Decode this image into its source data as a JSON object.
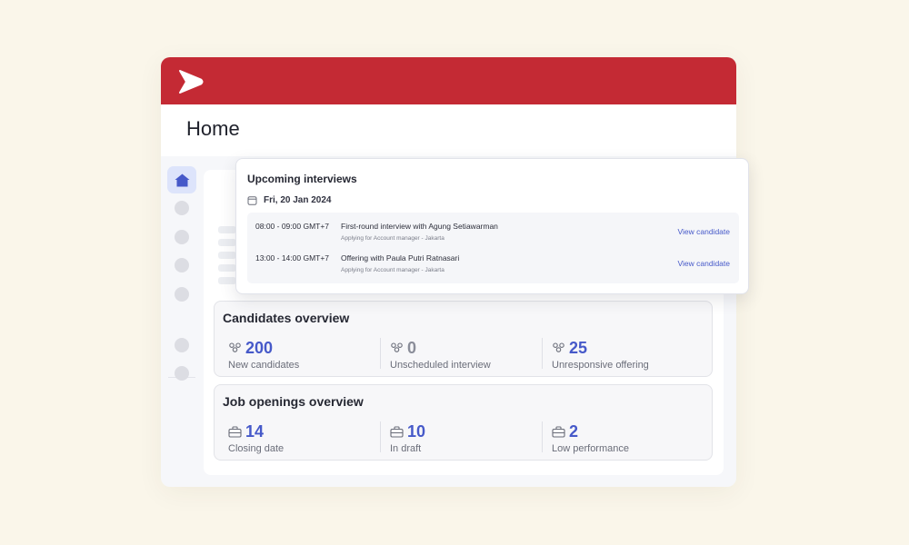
{
  "colors": {
    "brand": "#c42a34",
    "accent": "#4659c9",
    "background": "#faf6ea"
  },
  "header": {
    "title": "Home"
  },
  "sidebar": {
    "items": [
      {
        "icon": "home-icon",
        "active": true
      },
      {
        "icon": "nav-dot"
      },
      {
        "icon": "nav-dot"
      },
      {
        "icon": "nav-dot"
      },
      {
        "icon": "nav-dot"
      },
      {
        "icon": "nav-dot"
      },
      {
        "icon": "nav-dot"
      }
    ]
  },
  "upcoming": {
    "title": "Upcoming interviews",
    "date": "Fri, 20 Jan 2024",
    "interviews": [
      {
        "time": "08:00 - 09:00 GMT+7",
        "title": "First-round interview with Agung Setiawarman",
        "subtitle": "Applying for Account manager - Jakarta",
        "link": "View candidate"
      },
      {
        "time": "13:00 - 14:00 GMT+7",
        "title": "Offering with Paula Putri Ratnasari",
        "subtitle": "Applying for Account manager - Jakarta",
        "link": "View candidate"
      }
    ]
  },
  "candidates": {
    "title": "Candidates overview",
    "stats": [
      {
        "value": "200",
        "label": "New candidates",
        "icon": "people-icon"
      },
      {
        "value": "0",
        "label": "Unscheduled interview",
        "icon": "people-icon"
      },
      {
        "value": "25",
        "label": "Unresponsive offering",
        "icon": "people-icon"
      }
    ]
  },
  "jobs": {
    "title": "Job openings overview",
    "stats": [
      {
        "value": "14",
        "label": "Closing date",
        "icon": "briefcase-icon"
      },
      {
        "value": "10",
        "label": "In draft",
        "icon": "briefcase-icon"
      },
      {
        "value": "2",
        "label": "Low performance",
        "icon": "briefcase-icon"
      }
    ]
  }
}
